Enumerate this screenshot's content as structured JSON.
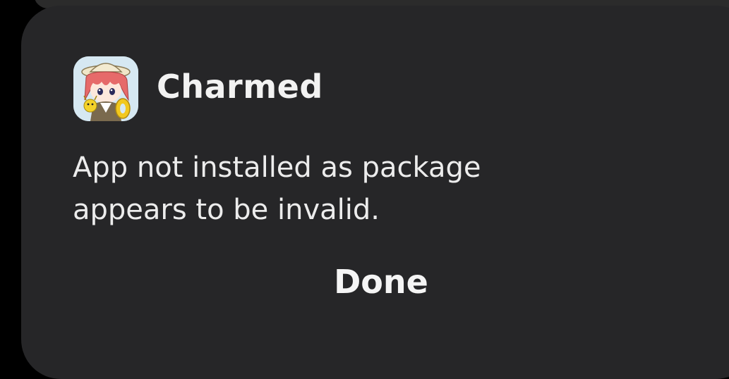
{
  "dialog": {
    "app_icon": "charmed-app-icon",
    "app_name": "Charmed",
    "message_line1": "App not installed as package",
    "message_line2": "appears to be invalid.",
    "done_label": "Done"
  },
  "colors": {
    "background": "#000000",
    "dialog_surface": "#262628",
    "text": "#ececec"
  }
}
